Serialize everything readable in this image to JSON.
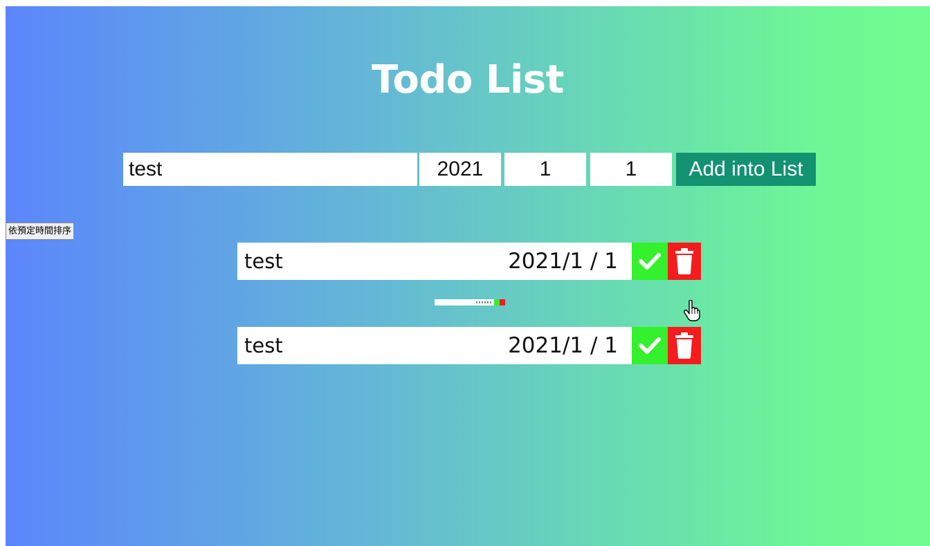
{
  "app": {
    "title": "Todo List"
  },
  "form": {
    "task_value": "test",
    "year_value": "2021",
    "month_value": "1",
    "day_value": "1",
    "add_label": "Add into List"
  },
  "sort": {
    "label": "依預定時間排序"
  },
  "todos": [
    {
      "text": "test",
      "date": "2021/1 / 1"
    },
    {
      "text": "test",
      "date": "2021/1 / 1"
    }
  ],
  "icons": {
    "complete": "check-icon",
    "delete": "trash-icon",
    "cursor": "hand-pointer-icon"
  },
  "colors": {
    "gradient_start": "#5b86fb",
    "gradient_end": "#70fd8f",
    "add_button": "#129271",
    "check_button": "#35f02d",
    "delete_button": "#f41c1c"
  }
}
